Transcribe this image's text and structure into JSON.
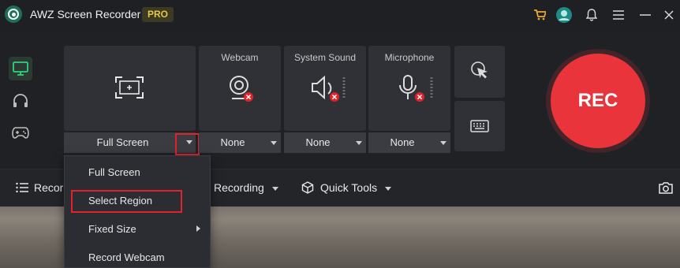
{
  "app": {
    "title": "AWZ Screen Recorder",
    "badge": "PRO"
  },
  "titlebar_icons": [
    "cart-icon",
    "avatar",
    "bell-icon",
    "menu-icon",
    "minimize-icon",
    "close-icon"
  ],
  "rail": [
    {
      "name": "screen-icon",
      "active": true
    },
    {
      "name": "headphones-icon",
      "active": false
    },
    {
      "name": "gamepad-icon",
      "active": false
    }
  ],
  "capture": {
    "mode_label": "Full Screen"
  },
  "webcam": {
    "label": "Webcam",
    "value": "None"
  },
  "system_sound": {
    "label": "System Sound",
    "value": "None"
  },
  "microphone": {
    "label": "Microphone",
    "value": "None"
  },
  "rec": {
    "label": "REC"
  },
  "toolbar": {
    "records_label": "Record",
    "recording_label": "Recording",
    "quick_tools_label": "Quick Tools"
  },
  "menu": {
    "items": [
      "Full Screen",
      "Select Region",
      "Fixed Size",
      "Record Webcam"
    ]
  },
  "colors": {
    "accent_red": "#e8343a",
    "highlight": "#e0232a",
    "pro": "#e7c54a",
    "cart": "#e7a73a"
  }
}
